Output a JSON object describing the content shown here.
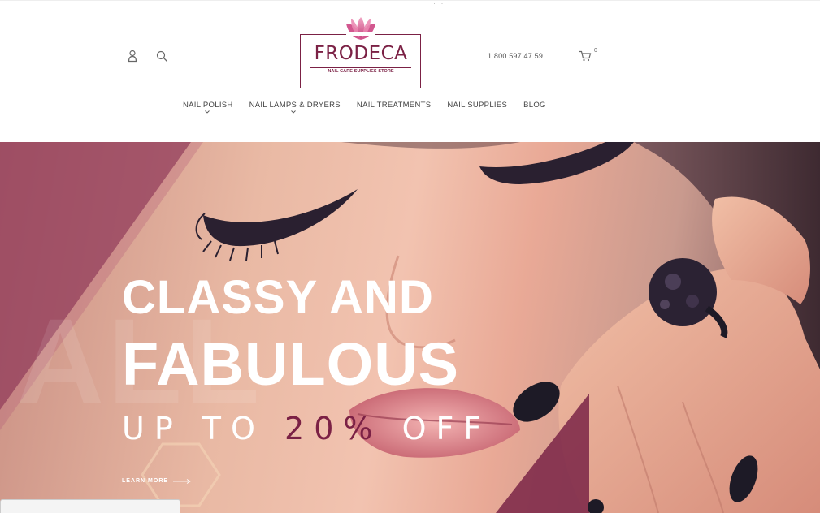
{
  "header": {
    "logo": {
      "brand": "FRODECA",
      "tagline": "NAIL CARE SUPPLIES STORE"
    },
    "phone": "1 800 597 47 59",
    "cart_count": "0",
    "icons": {
      "account": "user-icon",
      "search": "search-icon",
      "cart": "cart-icon"
    }
  },
  "nav": {
    "items": [
      {
        "label": "NAIL POLISH",
        "has_dropdown": true
      },
      {
        "label": "NAIL LAMPS & DRYERS",
        "has_dropdown": true
      },
      {
        "label": "NAIL TREATMENTS",
        "has_dropdown": false
      },
      {
        "label": "NAIL SUPPLIES",
        "has_dropdown": false
      },
      {
        "label": "BLOG",
        "has_dropdown": false
      }
    ]
  },
  "hero": {
    "title_line1": "CLASSY AND",
    "title_line2": "FABULOUS",
    "offer_prefix": "UP TO ",
    "offer_highlight": "20%",
    "offer_suffix": " OFF",
    "cta": "LEARN MORE",
    "background_word": "ALL"
  },
  "colors": {
    "brand": "#7b2145",
    "accent_pink": "#d15b8f",
    "text_dark": "#444444",
    "white": "#ffffff"
  }
}
